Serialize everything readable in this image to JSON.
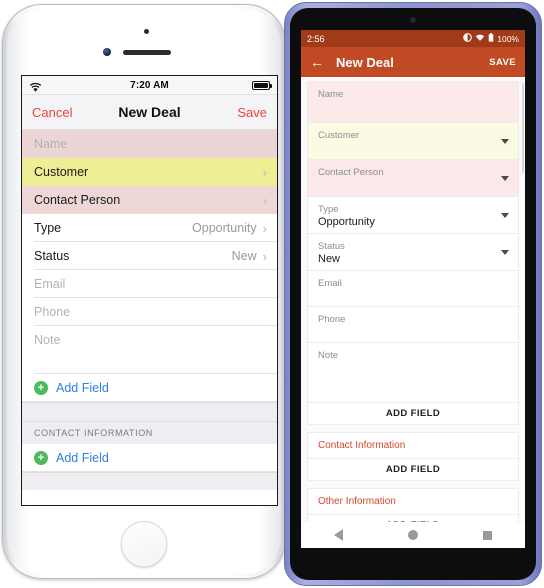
{
  "ios": {
    "status": {
      "time": "7:20 AM",
      "wifi_icon": "wifi-icon",
      "battery_icon": "battery-icon"
    },
    "navbar": {
      "cancel": "Cancel",
      "title": "New Deal",
      "save": "Save"
    },
    "rows": [
      {
        "label": "Name",
        "value": "",
        "style": "pink",
        "placeholder": true,
        "chevron": false
      },
      {
        "label": "Customer",
        "value": "",
        "style": "yellow",
        "placeholder": false,
        "chevron": true
      },
      {
        "label": "Contact Person",
        "value": "",
        "style": "pink2",
        "placeholder": false,
        "chevron": true
      },
      {
        "label": "Type",
        "value": "Opportunity",
        "style": "plain",
        "placeholder": false,
        "chevron": true
      },
      {
        "label": "Status",
        "value": "New",
        "style": "plain",
        "placeholder": false,
        "chevron": true
      },
      {
        "label": "Email",
        "value": "",
        "style": "plain",
        "placeholder": true,
        "chevron": false
      },
      {
        "label": "Phone",
        "value": "",
        "style": "plain",
        "placeholder": true,
        "chevron": false
      },
      {
        "label": "Note",
        "value": "",
        "style": "plain",
        "placeholder": true,
        "chevron": false
      }
    ],
    "add_field_label": "Add Field",
    "section_header": "CONTACT INFORMATION",
    "add_field_label_2": "Add Field",
    "plus_icon": "plus-circle-icon",
    "home_button": "home-button"
  },
  "android": {
    "status": {
      "time": "2:56",
      "battery_text": "100%",
      "alarm_icon": "alarm-icon",
      "wifi_icon": "wifi-icon",
      "battery_icon": "battery-icon"
    },
    "appbar": {
      "back_icon": "back-arrow-icon",
      "title": "New Deal",
      "save": "SAVE"
    },
    "fields": [
      {
        "label": "Name",
        "value": "",
        "style": "pink",
        "dropdown": false,
        "size": "h-name"
      },
      {
        "label": "Customer",
        "value": "",
        "style": "yellow",
        "dropdown": true,
        "size": "h-sel"
      },
      {
        "label": "Contact Person",
        "value": "",
        "style": "pink2",
        "dropdown": true,
        "size": "h-sel"
      },
      {
        "label": "Type",
        "value": "Opportunity",
        "style": "plain",
        "dropdown": true,
        "size": "h-sel"
      },
      {
        "label": "Status",
        "value": "New",
        "style": "plain",
        "dropdown": true,
        "size": "h-sel"
      },
      {
        "label": "Email",
        "value": "",
        "style": "plain",
        "dropdown": false,
        "size": "h-basic"
      },
      {
        "label": "Phone",
        "value": "",
        "style": "plain",
        "dropdown": false,
        "size": "h-basic"
      },
      {
        "label": "Note",
        "value": "",
        "style": "plain",
        "dropdown": false,
        "size": "h-note"
      }
    ],
    "add_field_main": "ADD FIELD",
    "section_contact": {
      "title": "Contact Information",
      "add_field": "ADD FIELD"
    },
    "section_other": {
      "title": "Other Information",
      "add_field": "ADD FIELD"
    },
    "navbar": {
      "back_icon": "nav-back-icon",
      "home_icon": "nav-home-icon",
      "recents_icon": "nav-recents-icon"
    }
  },
  "colors": {
    "ios_accent_red": "#e8453c",
    "ios_link_blue": "#2f7fe0",
    "ios_green": "#4cbb5c",
    "android_appbar": "#bf4a24",
    "android_statusbar": "#a03a18",
    "android_section_red": "#d0492a",
    "highlight_pink": "#ecd5d5",
    "highlight_yellow": "#eeee95"
  }
}
